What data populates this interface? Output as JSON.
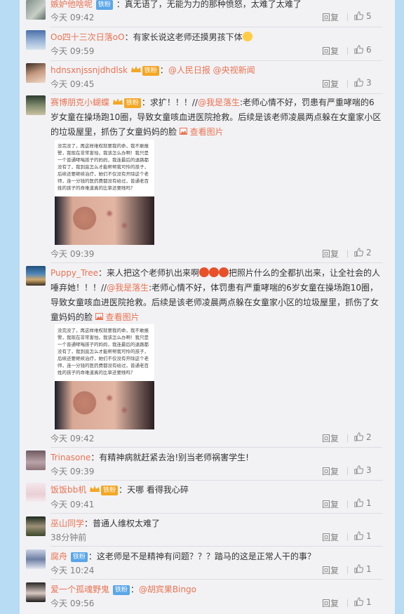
{
  "comments": [
    {
      "user": "嫉妒他啥呢",
      "badge": "铁粉",
      "text": "：真无语了，无能为力的那种愤怒，太难了太难了",
      "time": "今天 09:42",
      "reply": "回复",
      "likes": "5"
    },
    {
      "user": "Oo四十三次日落oO",
      "text": "：有家长说这老师还摸男孩下体",
      "time": "今天 09:59",
      "reply": "回复",
      "likes": "6"
    },
    {
      "user": "hdnsxnjssnjdhdlsk",
      "badge": "铁粉",
      "text_pre": "：",
      "mention1": "@人民日报",
      "mention2": "@央视新闻",
      "time": "今天 09:45",
      "reply": "回复",
      "likes": "3"
    },
    {
      "user": "赛博朋克小蝴蝶",
      "badge": "铁粉",
      "text_pre": "：求扩！！！//",
      "mention": "@我是落生",
      "text": ":老师心情不好，罚患有严重哮喘的6岁女童在操场跑10圈，导致女童咳血进医院抢救。后续是该老师凌晨两点躲在女童家小区的垃圾屋里，抓伤了女童妈妈的脸",
      "pic": "查看图片",
      "attach_text": "没完没了，再这样维权就要我的命，我不敢报警，我现在非常害怕，我该怎么办啊！我只是一个普通哮喘孩子的妈妈，我连最后的退路都没有了，我到底怎么才能帮帮我可怜的孩子，后续还要继续治疗，她们不仅没有开除这个老师，连一分钱的医药费都没有给过，普通老百姓的孩子的命难道真的比草还要贱吗？",
      "time": "今天 09:39",
      "reply": "回复",
      "likes": "2"
    },
    {
      "user": "Puppy_Tree",
      "text_pre": "：来人把这个老师扒出来啊",
      "text_post": "把照片什么的全都扒出来，让全社会的人唾弃她！！！//",
      "mention": "@我是落生",
      "text": ":老师心情不好，体罚患有严重哮喘的6岁女童在操场跑10圈，导致女童咳血进医院抢救。后续是该老师凌晨两点躲在女童家小区的垃圾屋里，抓伤了女童妈妈的脸",
      "pic": "查看图片",
      "attach_text": "没完没了，再这样维权就要我的命，我不敢报警，我现在非常害怕，我该怎么办啊！我只是一个普通哮喘孩子的妈妈，我连最后的退路都没有了，我到底怎么才能帮帮我可怜的孩子，后续还要继续治疗，她们不仅没有开除这个老师，连一分钱的医药费都没有给过，普通老百姓的孩子的命难道真的比草还要贱吗？",
      "time": "今天 09:42",
      "reply": "回复",
      "likes": "2"
    },
    {
      "user": "Trinasone",
      "text": "：有精神病就赶紧去治!别当老师祸害学生!",
      "time": "今天 09:39",
      "reply": "回复",
      "likes": "3"
    },
    {
      "user": "饭饭bb机",
      "badge": "铁粉",
      "text": "：天哪 看得我心碎",
      "time": "今天 09:41",
      "reply": "回复",
      "likes": "1"
    },
    {
      "user": "巫山同学",
      "text": "：普通人维权太难了",
      "time": "38分钟前",
      "reply": "回复",
      "likes": "1"
    },
    {
      "user": "腐舟",
      "badge": "铁粉",
      "text": "：这老师是不是精神有问题？？？踏马的这是正常人干的事？",
      "time": "今天 10:24",
      "reply": "回复",
      "likes": "1"
    },
    {
      "user": "爱一个孤魂野鬼",
      "badge": "铁粉",
      "text_pre": "：",
      "mention": "@胡宾果Bingo",
      "time": "今天 09:56",
      "reply": "回复",
      "likes": "1"
    }
  ],
  "colors": {
    "link": "#eb7350",
    "badge_blue": "#5aa6e8",
    "badge_gold": "#f5a623",
    "page_bg": "#b7dcf3",
    "panel_bg": "#f2f2f5"
  },
  "icons": {
    "like": "thumb-up-icon",
    "picture": "picture-icon",
    "vip": "crown-icon"
  }
}
